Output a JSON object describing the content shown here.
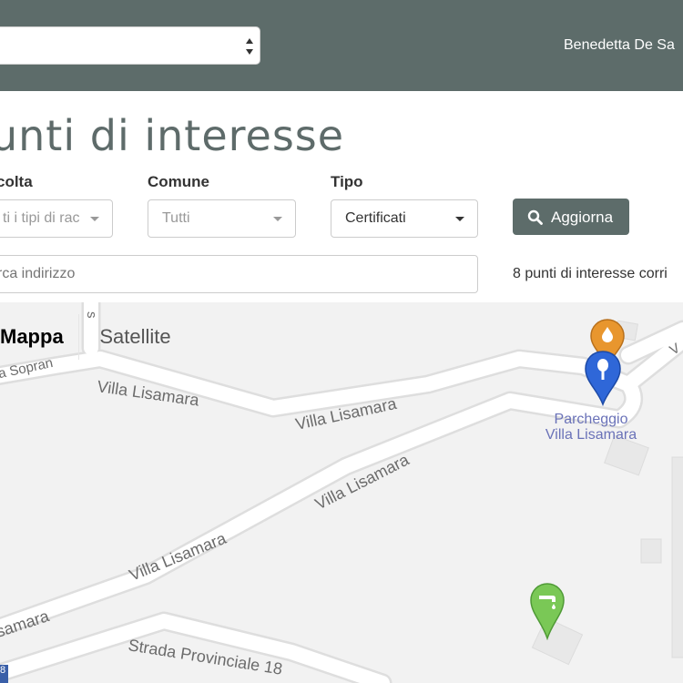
{
  "header": {
    "user_name": "Benedetta De Sa",
    "select_value": ""
  },
  "page": {
    "title": "unti di interesse"
  },
  "filters": {
    "raccolta_label": "colta",
    "raccolta_value": "ti i tipi di rac",
    "comune_label": "Comune",
    "comune_value": "Tutti",
    "tipo_label": "Tipo",
    "tipo_value": "Certificati",
    "update_label": "Aggiorna",
    "search_placeholder": "rca indirizzo",
    "result_count": "8 punti di interesse corri"
  },
  "map": {
    "tab_map": "Mappa",
    "tab_satellite": "Satellite",
    "roads": {
      "sopra": "la Sopran",
      "sopra_vertical": "s",
      "villa_lisamara": "Villa Lisamara",
      "strada": "Strada Provinciale 18",
      "samara": "samara",
      "corner_v": "V"
    },
    "poi": {
      "line1": "Parcheggio",
      "line2": "Villa Lisamara"
    },
    "markers": [
      {
        "name": "oil-marker",
        "color": "#e8962e"
      },
      {
        "name": "glass-marker",
        "color": "#2f67d8"
      },
      {
        "name": "water-marker",
        "color": "#7ac856"
      }
    ],
    "corner_badge": "8"
  }
}
